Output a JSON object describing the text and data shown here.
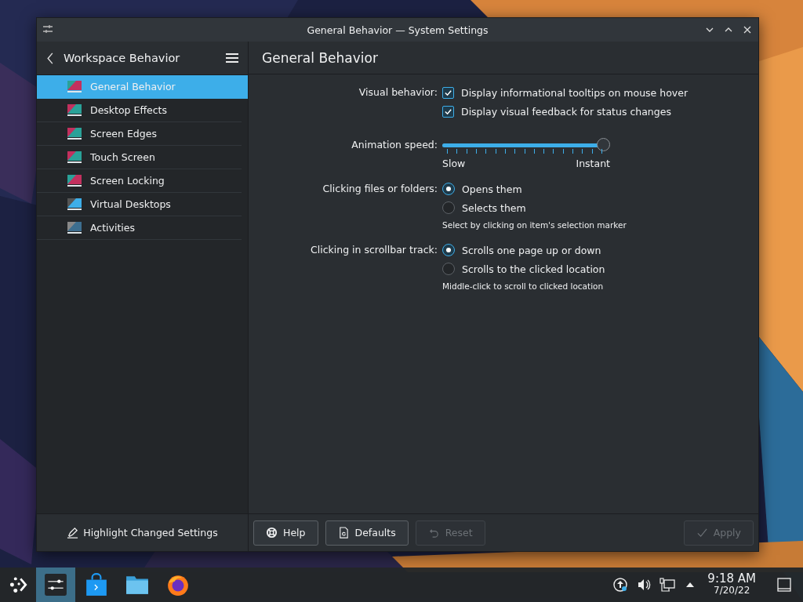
{
  "window": {
    "title": "General Behavior — System Settings"
  },
  "sidebar": {
    "title": "Workspace Behavior",
    "items": [
      {
        "label": "General Behavior",
        "selected": true
      },
      {
        "label": "Desktop Effects",
        "selected": false
      },
      {
        "label": "Screen Edges",
        "selected": false
      },
      {
        "label": "Touch Screen",
        "selected": false
      },
      {
        "label": "Screen Locking",
        "selected": false
      },
      {
        "label": "Virtual Desktops",
        "selected": false
      },
      {
        "label": "Activities",
        "selected": false
      }
    ],
    "footer_button": "Highlight Changed Settings"
  },
  "page": {
    "title": "General Behavior",
    "settings": [
      {
        "kind": "checkboxes",
        "label": "Visual behavior:",
        "options": [
          {
            "label": "Display informational tooltips on mouse hover",
            "checked": true
          },
          {
            "label": "Display visual feedback for status changes",
            "checked": true
          }
        ]
      },
      {
        "kind": "slider",
        "label": "Animation speed:",
        "level": 1.0,
        "min_label": "Slow",
        "max_label": "Instant"
      },
      {
        "kind": "radios",
        "label": "Clicking files or folders:",
        "options": [
          {
            "label": "Opens them",
            "selected": true
          },
          {
            "label": "Selects them",
            "selected": false
          }
        ],
        "hint": "Select by clicking on item's selection marker"
      },
      {
        "kind": "radios",
        "label": "Clicking in scrollbar track:",
        "options": [
          {
            "label": "Scrolls one page up or down",
            "selected": true
          },
          {
            "label": "Scrolls to the clicked location",
            "selected": false
          }
        ],
        "hint": "Middle-click to scroll to clicked location"
      }
    ]
  },
  "buttons": [
    {
      "kind": "help",
      "label": "Help",
      "disabled": false
    },
    {
      "kind": "defaults",
      "label": "Defaults",
      "disabled": false
    },
    {
      "kind": "reset",
      "label": "Reset",
      "disabled": true
    },
    {
      "kind": "apply",
      "label": "Apply",
      "disabled": true
    }
  ],
  "taskbar": {
    "tasks": [
      {
        "kind": "settings",
        "selected": true
      },
      {
        "kind": "store",
        "selected": false
      },
      {
        "kind": "folder",
        "selected": false
      },
      {
        "kind": "browser",
        "selected": false
      }
    ],
    "clock": {
      "time": "9:18 AM",
      "date": "7/20/22"
    }
  }
}
